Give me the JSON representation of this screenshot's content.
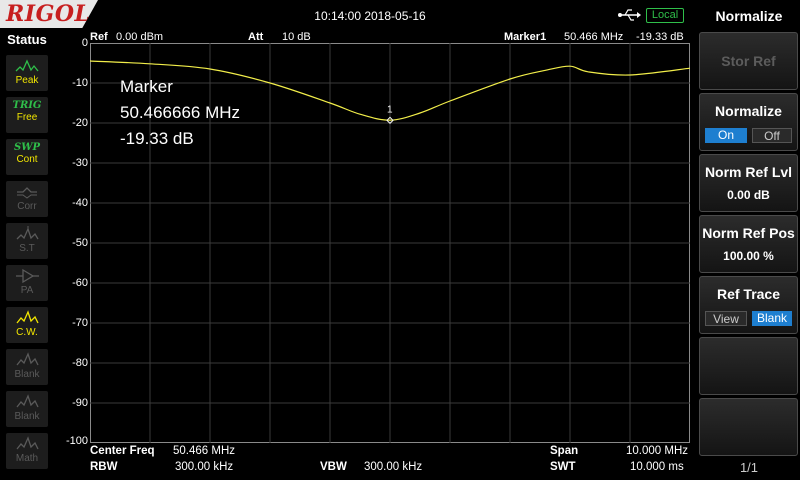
{
  "header": {
    "logo": "RIGOL",
    "datetime": "10:14:00 2018-05-16",
    "remote_badge": "Local"
  },
  "status": {
    "title": "Status",
    "items": [
      {
        "label": "Peak",
        "icon": "peak-icon",
        "state": "on"
      },
      {
        "label": "TRIG",
        "sub": "Free",
        "icon": "trig-icon",
        "state": "on"
      },
      {
        "label": "SWP",
        "sub": "Cont",
        "icon": "sweep-icon",
        "state": "on"
      },
      {
        "label": "Corr",
        "icon": "corr-icon",
        "state": "off"
      },
      {
        "label": "S.T",
        "icon": "signal-track-icon",
        "state": "off"
      },
      {
        "label": "PA",
        "icon": "preamp-icon",
        "state": "off"
      },
      {
        "label": "C.W.",
        "icon": "trace-write-icon",
        "state": "on"
      },
      {
        "label": "Blank",
        "icon": "trace-blank-icon",
        "state": "off"
      },
      {
        "label": "Blank",
        "icon": "trace-blank-icon",
        "state": "off"
      },
      {
        "label": "Math",
        "icon": "math-icon",
        "state": "off"
      }
    ]
  },
  "measurement": {
    "ref_label": "Ref",
    "ref_value": "0.00 dBm",
    "att_label": "Att",
    "att_value": "10 dB",
    "marker_label": "Marker1",
    "marker_freq": "50.466 MHz",
    "marker_level": "-19.33 dB",
    "marker_number": "1"
  },
  "marker_readout": {
    "title": "Marker",
    "freq": "50.466666 MHz",
    "level": "-19.33 dB"
  },
  "footer": {
    "center_freq_label": "Center Freq",
    "center_freq_value": "50.466 MHz",
    "span_label": "Span",
    "span_value": "10.000 MHz",
    "rbw_label": "RBW",
    "rbw_value": "300.00 kHz",
    "vbw_label": "VBW",
    "vbw_value": "300.00 kHz",
    "swt_label": "SWT",
    "swt_value": "10.000 ms"
  },
  "menu": {
    "title": "Normalize",
    "stor_ref": "Stor Ref",
    "normalize_label": "Normalize",
    "normalize_on": "On",
    "normalize_off": "Off",
    "norm_ref_lvl_label": "Norm Ref Lvl",
    "norm_ref_lvl_value": "0.00 dB",
    "norm_ref_pos_label": "Norm Ref Pos",
    "norm_ref_pos_value": "100.00 %",
    "ref_trace_label": "Ref Trace",
    "ref_trace_view": "View",
    "ref_trace_blank": "Blank",
    "page": "1/1"
  },
  "colors": {
    "trace": "#f2ee4a",
    "grid": "#3a3a3a",
    "accent": "#1e7fd0",
    "logo_red": "#c71f1f",
    "status_green": "#2fbf4a"
  },
  "chart_data": {
    "type": "line",
    "ylim": [
      -100,
      0
    ],
    "xlim_MHz": [
      45.466,
      55.466
    ],
    "y_ticks": [
      "0",
      "-10",
      "-20",
      "-30",
      "-40",
      "-50",
      "-60",
      "-70",
      "-80",
      "-90",
      "-100"
    ],
    "series": [
      {
        "x": [
          45.466,
          46.466,
          47.466,
          48.466,
          49.466,
          49.966,
          50.466,
          50.966,
          51.466,
          52.466,
          53.066,
          53.466,
          53.766,
          54.466,
          55.466
        ],
        "y": [
          -4.5,
          -5.2,
          -6.5,
          -10.0,
          -15.0,
          -17.8,
          -19.3,
          -17.5,
          -14.5,
          -9.0,
          -6.8,
          -5.8,
          -7.2,
          -8.0,
          -6.3
        ]
      }
    ],
    "marker": {
      "x": 50.466,
      "y": -19.33,
      "label": "1"
    }
  }
}
